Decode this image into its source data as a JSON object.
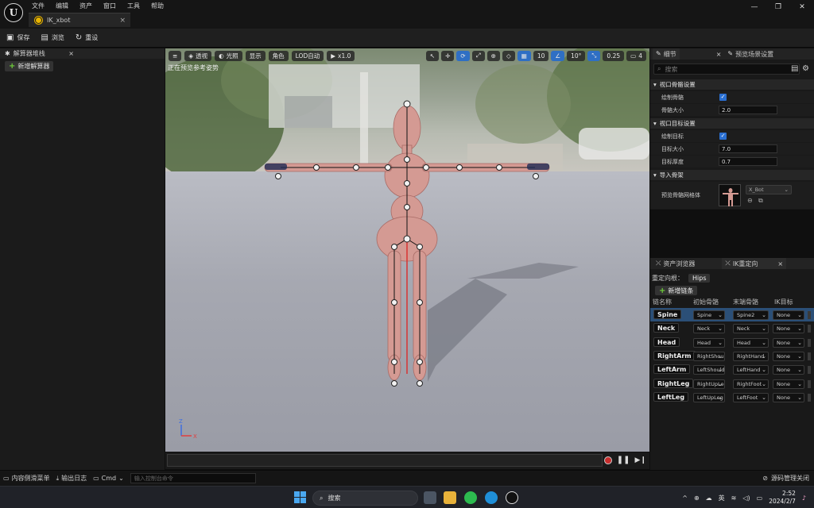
{
  "titlebar": {
    "logo": "U",
    "menus": [
      "文件",
      "编辑",
      "资产",
      "窗口",
      "工具",
      "帮助"
    ],
    "doc_tab": "IK_xbot",
    "doc_tab_close": "×",
    "window_controls": [
      "—",
      "❐",
      "✕"
    ]
  },
  "toolbar": {
    "save": "保存",
    "browse": "浏览",
    "reset": "重设"
  },
  "left_panel": {
    "title": "解算器堆栈",
    "close": "×",
    "add_solver": "新增解算器"
  },
  "viewport": {
    "perspective": "透视",
    "lighting": "光照",
    "show": "显示",
    "character": "角色",
    "lod": "LOD自动",
    "speed": "x1.0",
    "grid_value": "10",
    "angle_value": "10°",
    "scale_value": "0.25",
    "camera_value": "4",
    "status": "正在预览参考姿势",
    "axis_z": "Z",
    "axis_x": "X"
  },
  "details": {
    "tab_details": "细节",
    "tab_scene": "预览场景设置",
    "tab_close": "×",
    "search_placeholder": "搜索",
    "section_bones": "视口骨骼设置",
    "draw_bones": "绘制骨骼",
    "bone_size_label": "骨骼大小",
    "bone_size": "2.0",
    "section_goals": "视口目标设置",
    "draw_goals": "绘制目标",
    "goal_size_label": "目标大小",
    "goal_size": "7.0",
    "goal_thickness_label": "目标厚度",
    "goal_thickness": "0.7",
    "section_import": "导入骨架",
    "preview_mesh_label": "预览骨骼网格体",
    "preview_mesh_value": "X_Bot"
  },
  "retarget": {
    "tab_assets": "资产浏览器",
    "tab_ik": "IK重定向",
    "tab_close": "×",
    "root_label": "重定向根：",
    "root_value": "Hips",
    "add_chain": "新增链条",
    "columns": [
      "链名称",
      "初始骨骼",
      "末端骨骼",
      "IK目标"
    ],
    "chains": [
      {
        "name": "Spine",
        "start": "Spine",
        "end": "Spine2",
        "goal": "None"
      },
      {
        "name": "Neck",
        "start": "Neck",
        "end": "Neck",
        "goal": "None"
      },
      {
        "name": "Head",
        "start": "Head",
        "end": "Head",
        "goal": "None"
      },
      {
        "name": "RightArm",
        "start": "RightShoulder",
        "end": "RightHand",
        "goal": "None"
      },
      {
        "name": "LeftArm",
        "start": "LeftShoulder",
        "end": "LeftHand",
        "goal": "None"
      },
      {
        "name": "RightLeg",
        "start": "RightUpLeg",
        "end": "RightFoot",
        "goal": "None"
      },
      {
        "name": "LeftLeg",
        "start": "LeftUpLeg",
        "end": "LeftFoot",
        "goal": "None"
      }
    ]
  },
  "statusbar": {
    "content_drawer": "内容侧滑菜单",
    "output_log": "输出日志",
    "cmd": "Cmd",
    "cmd_placeholder": "输入控制台命令",
    "source_control": "源码管理关闭"
  },
  "taskbar": {
    "search": "搜索",
    "lang": "英",
    "time": "2:52",
    "date": "2024/2/7",
    "caret": "^"
  }
}
